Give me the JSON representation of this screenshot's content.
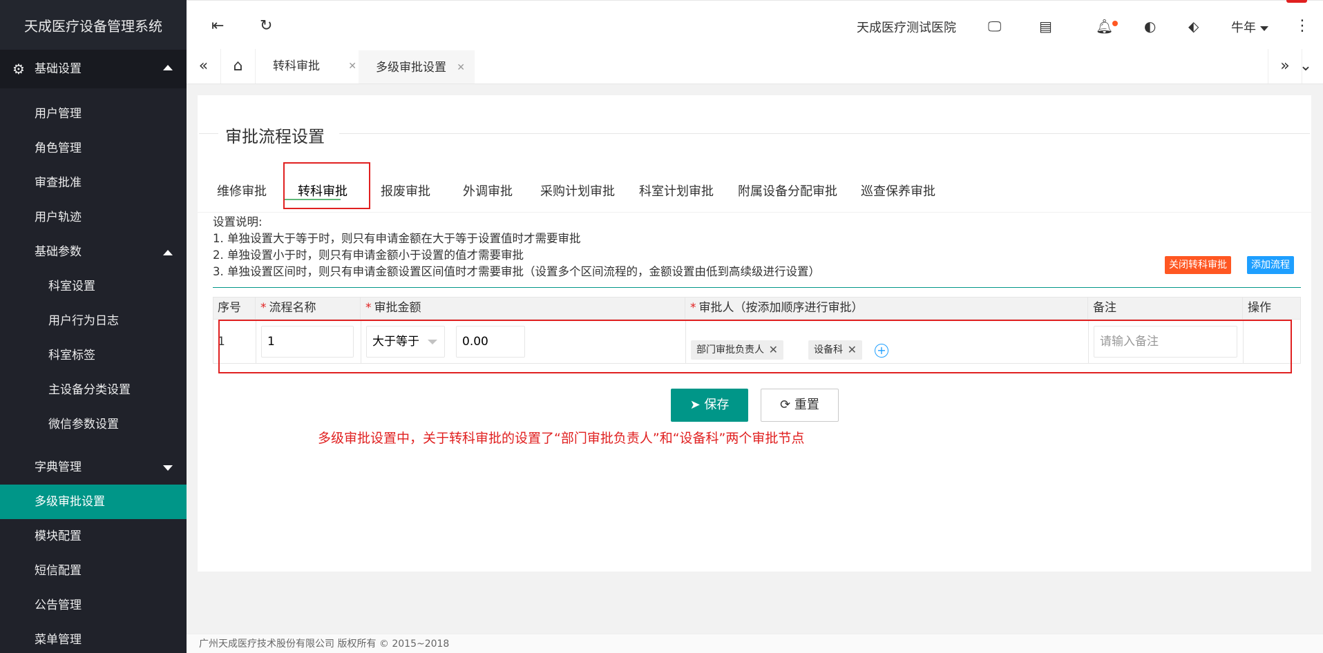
{
  "app": {
    "title": "天成医疗设备管理系统"
  },
  "sidebar": {
    "group": "基础设置",
    "items": [
      "用户管理",
      "角色管理",
      "审查批准",
      "用户轨迹"
    ],
    "params_label": "基础参数",
    "params_items": [
      "科室设置",
      "用户行为日志",
      "科室标签",
      "主设备分类设置",
      "微信参数设置"
    ],
    "after_items": [
      "字典管理",
      "多级审批设置",
      "模块配置",
      "短信配置",
      "公告管理",
      "菜单管理"
    ]
  },
  "header": {
    "hospital": "天成医疗测试医院",
    "user": "牛年",
    "icons": [
      "menu-fold-icon",
      "refresh-icon",
      "monitor-icon",
      "note-icon",
      "bell-icon",
      "palette-icon",
      "tag-icon",
      "more-icon"
    ]
  },
  "pagetabs": {
    "tabs": [
      "转科审批",
      "多级审批设置"
    ]
  },
  "form": {
    "legend": "审批流程设置",
    "tabs": [
      "维修审批",
      "转科审批",
      "报废审批",
      "外调审批",
      "采购计划审批",
      "科室计划审批",
      "附属设备分配审批",
      "巡查保养审批"
    ],
    "desc": [
      "设置说明:",
      "1. 单独设置大于等于时，则只有申请金额在大于等于设置值时才需要审批",
      "2. 单独设置小于时，则只有申请金额小于设置的值才需要审批",
      "3. 单独设置区间时，则只有申请金额设置区间值时才需要审批（设置多个区间流程的，金额设置由低到高续级进行设置）"
    ],
    "close_button": "关闭转科审批",
    "add_button": "添加流程",
    "table": {
      "headers": {
        "seq": "序号",
        "name": "流程名称",
        "amount": "审批金额",
        "approver": "审批人（按添加顺序进行审批）",
        "note": "备注",
        "op": "操作"
      },
      "row": {
        "seq": "1",
        "name": "1",
        "cond": "大于等于",
        "amount": "0.00",
        "tags": [
          "部门审批负责人",
          "设备科"
        ],
        "note_placeholder": "请输入备注"
      }
    },
    "save": "保存",
    "reset": "重置",
    "annotation": "多级审批设置中，关于转科审批的设置了“部门审批负责人”和“设备科”两个审批节点"
  },
  "footer": "广州天成医疗技术股份有限公司 版权所有 © 2015~2018",
  "colors": {
    "sidebar": "#20222a",
    "active": "#009688",
    "danger": "#ff5722",
    "primary": "#1e9fff",
    "highlight": "#e02020"
  }
}
